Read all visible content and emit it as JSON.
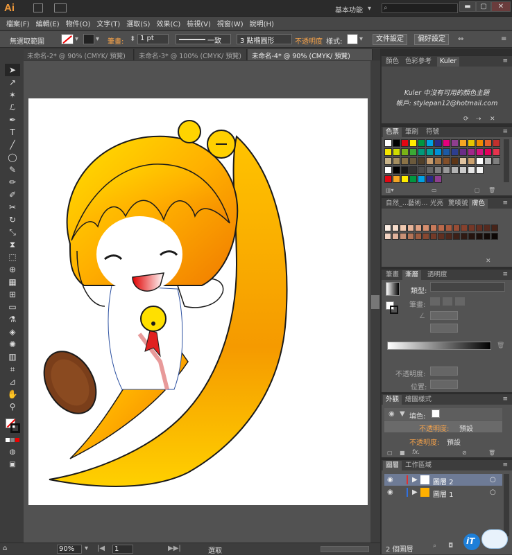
{
  "app": {
    "logo": "Ai",
    "workspace": "基本功能",
    "win_min": "▬",
    "win_max": "▢",
    "win_close": "✕"
  },
  "menu": [
    "檔案(F)",
    "編輯(E)",
    "物件(O)",
    "文字(T)",
    "選取(S)",
    "效果(C)",
    "檢視(V)",
    "視窗(W)",
    "說明(H)"
  ],
  "control": {
    "selection": "無選取範圍",
    "stroke_label": "筆畫:",
    "stroke_value": "1 pt",
    "profile": "一致",
    "brush": "3 點橢圓形",
    "opacity_label": "不透明度",
    "style_label": "樣式:",
    "doc_setup": "文件設定",
    "prefs": "偏好設定"
  },
  "tabs": [
    {
      "label": "未命名-2* @ 90% (CMYK/ 預覽)",
      "active": false
    },
    {
      "label": "未命名-3* @ 100% (CMYK/ 預覽)",
      "active": false
    },
    {
      "label": "未命名-4* @ 90% (CMYK/ 預覽)",
      "active": true
    }
  ],
  "status": {
    "zoom": "90%",
    "page": "1",
    "mode": "選取"
  },
  "panels": {
    "kuler": {
      "tabs": [
        "顏色",
        "色彩參考",
        "Kuler"
      ],
      "msg1": "Kuler 中沒有可用的顏色主題",
      "msg2": "帳戶: stylepan12@hotmail.com"
    },
    "swatches": {
      "tabs": [
        "色票",
        "筆刷",
        "符號"
      ]
    },
    "brushlib": {
      "tabs": [
        "自然_…",
        "藝術…",
        "光亮",
        "驚嘆號",
        "膚色"
      ]
    },
    "gradient": {
      "tabs": [
        "筆畫",
        "漸層",
        "透明度"
      ],
      "type_label": "類型:",
      "stroke_label": "筆畫:",
      "opacity_label": "不透明度:",
      "position_label": "位置:"
    },
    "appearance": {
      "tabs": [
        "外觀",
        "繪圖樣式"
      ],
      "fill_label": "填色:",
      "opacity1": "不透明度:",
      "default1": "預設",
      "opacity2": "不透明度:",
      "default2": "預設",
      "fx": "fx."
    },
    "layers": {
      "tabs": [
        "圖層",
        "工作區域"
      ],
      "layer2": "圖層 2",
      "layer1": "圖層 1",
      "count": "2 個圖層"
    }
  },
  "colors": {
    "swatch_rows": [
      [
        "#ffffff",
        "#000000",
        "#e30613",
        "#ffed00",
        "#009640",
        "#00a0e3",
        "#2a2a86",
        "#e5007e",
        "#8e3e8f",
        "#f5a623",
        "#e8c600",
        "#f08a00",
        "#e5632b",
        "#c2302d"
      ],
      [
        "#f5e600",
        "#cfdd00",
        "#7ab317",
        "#3aaa35",
        "#009a7a",
        "#00a099",
        "#0091d5",
        "#1c5aa5",
        "#2d3e8f",
        "#6a2c87",
        "#a1288a",
        "#d4137f",
        "#e4005a",
        "#e6334d"
      ],
      [
        "#c8b48a",
        "#a58e5f",
        "#8b7346",
        "#6b5a3c",
        "#4f3f2a",
        "#c59b6d",
        "#a47446",
        "#834f29",
        "#5e3617",
        "#e0c3a0",
        "#cba16e",
        "#ffffff",
        "#bfbfbf",
        "#7f7f7f"
      ],
      [
        "#ffffff",
        "#000000",
        "#1a1a1a",
        "#333333",
        "#4d4d4d",
        "#666666",
        "#808080",
        "#999999",
        "#b3b3b3",
        "#cccccc",
        "#e6e6e6",
        "#f2f2f2"
      ],
      [
        "#e30613",
        "#f5a623",
        "#ffed00",
        "#009640",
        "#00a0e3",
        "#2a2a86",
        "#8e3e8f"
      ]
    ],
    "skin_row1": [
      "#fbeee4",
      "#f6dccb",
      "#f0c9b0",
      "#e8b59a",
      "#e0a183",
      "#d58e6e",
      "#c97b5b",
      "#bb6a4c",
      "#aa5b3f",
      "#984d35",
      "#86412d",
      "#743727",
      "#642f22",
      "#552a1f",
      "#472419"
    ],
    "skin_row2": [
      "#f2d3c2",
      "#dfb29b",
      "#c99176",
      "#b37457",
      "#9c5b40",
      "#874831",
      "#733a28",
      "#5f2f21",
      "#4d271c",
      "#3d2017",
      "#2f1a13",
      "#25140f",
      "#1b0f0b",
      "#130b08",
      "#0c0705"
    ]
  }
}
